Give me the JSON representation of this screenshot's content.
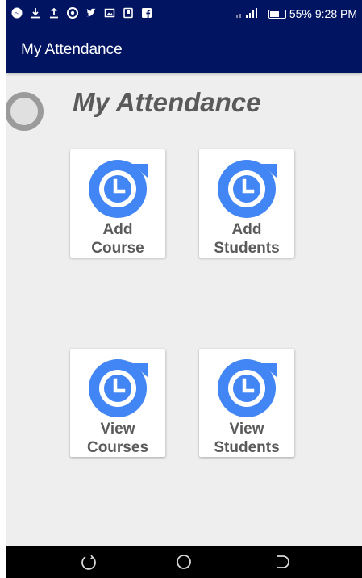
{
  "status_bar": {
    "left_icons": [
      "messenger-icon",
      "download-icon",
      "upload-icon",
      "chrome-icon",
      "twitter-icon",
      "gallery-icon",
      "notification-icon",
      "facebook-icon"
    ],
    "battery": "55%",
    "time": "9:28 PM"
  },
  "app_bar": {
    "title": "My Attendance"
  },
  "header": {
    "title": "My Attendance"
  },
  "tiles": [
    {
      "label": "Add\nCourse",
      "icon": "clock-refresh-icon"
    },
    {
      "label": "Add\nStudents",
      "icon": "clock-refresh-icon"
    },
    {
      "label": "View\nCourses",
      "icon": "clock-refresh-icon"
    },
    {
      "label": "View\nStudents",
      "icon": "clock-refresh-icon"
    }
  ],
  "nav_bar": {
    "buttons": [
      "recents-icon",
      "home-icon",
      "back-icon"
    ]
  },
  "colors": {
    "primary": "#001462",
    "icon_blue": "#4285f4",
    "text_gray": "#5a5a5a",
    "background": "#eeeeee"
  }
}
